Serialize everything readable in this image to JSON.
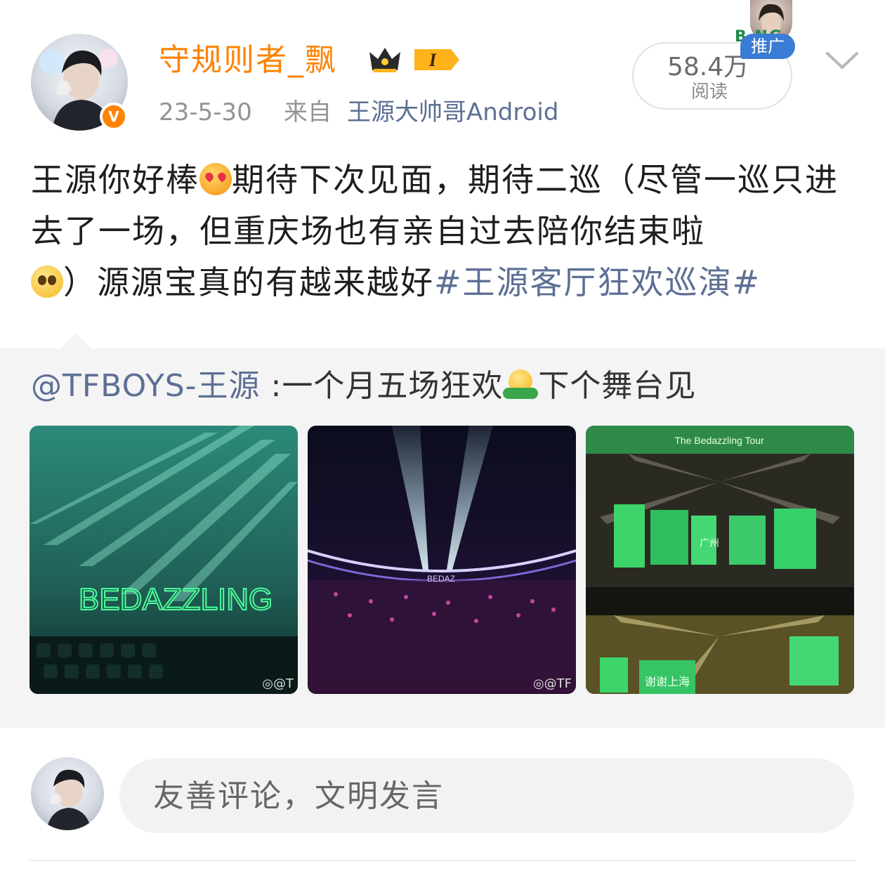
{
  "post": {
    "username": "守规则者_飘",
    "vip_level": "I",
    "date": "23-5-30",
    "source_prefix": "来自",
    "source_name": "王源大帅哥Android",
    "read_count": "58.4万",
    "read_label": "阅读",
    "promo_tag": "推广",
    "promo_deco_text": "B  NG",
    "text_part1": "王源你好棒",
    "text_part2": "期待下次见面，期待二巡（尽管一巡只进去了一场，但重庆场也有亲自过去陪你结束啦",
    "text_part3": "）源源宝真的有越来越好",
    "hashtag": "#王源客厅狂欢巡演#"
  },
  "repost": {
    "mention": "@TFBOYS-王源",
    "text_part1": " :一个月五场狂欢",
    "text_part2": "下个舞台见",
    "photos": [
      {
        "watermark": "◎@T",
        "overlay_text": "BEDAZZLING"
      },
      {
        "watermark": "◎@TF",
        "overlay_text": "BEDAZ"
      },
      {
        "watermark": "",
        "overlay_text": "The Bedazzling Tour",
        "screen_text_1": "广州",
        "screen_text_2": "谢谢上海"
      }
    ]
  },
  "comment": {
    "placeholder": "友善评论，文明发言"
  },
  "icons": {
    "verified_mark": "V",
    "chevron": "chevron-down-icon"
  },
  "colors": {
    "username": "#ff8200",
    "link": "#5d6f94",
    "verified": "#ff8200"
  }
}
